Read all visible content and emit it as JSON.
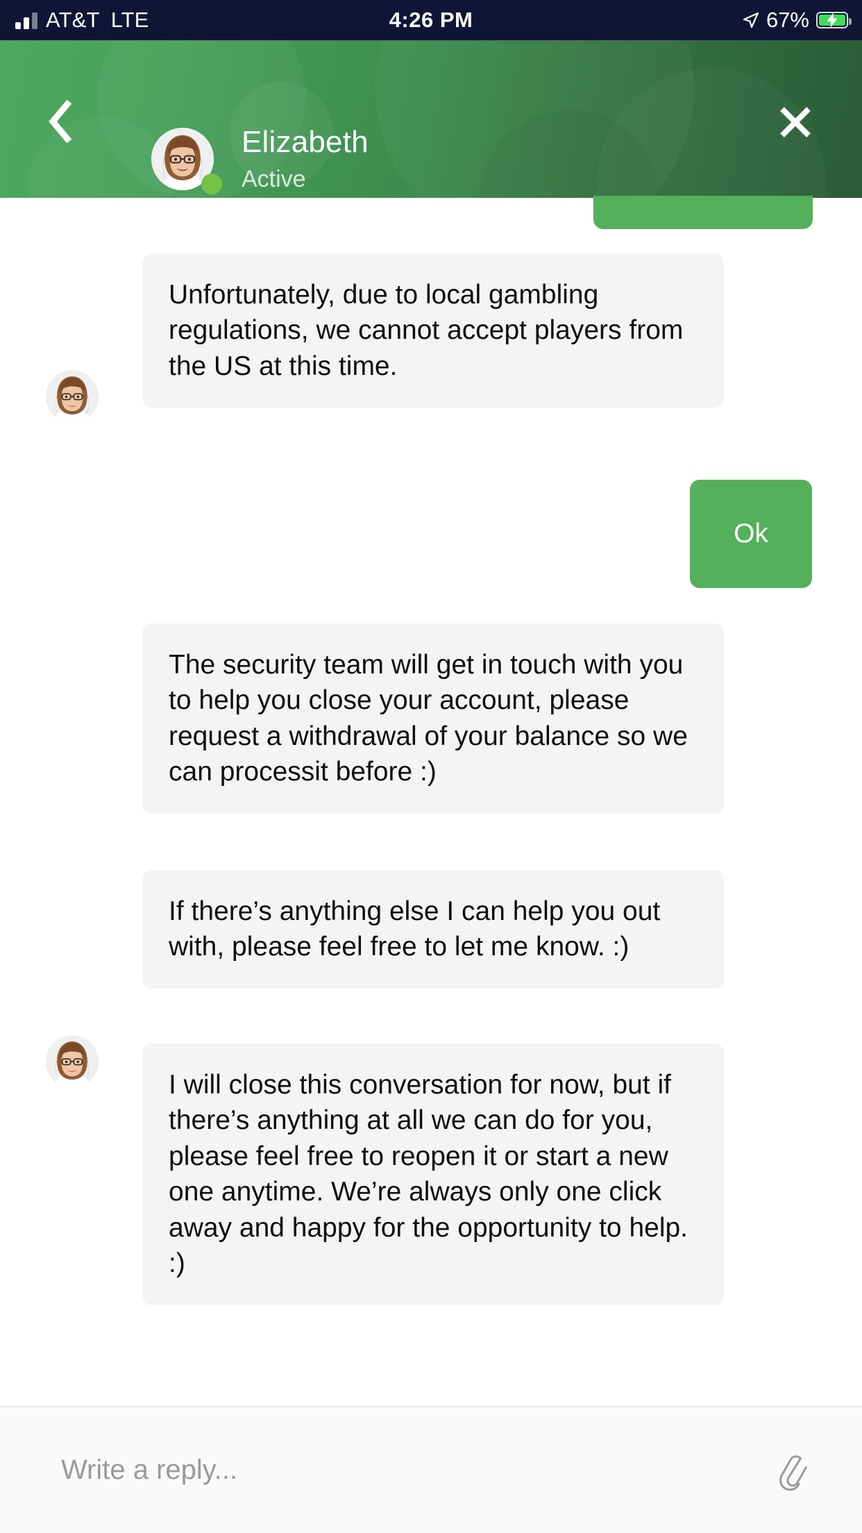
{
  "status_bar": {
    "carrier": "AT&T",
    "network": "LTE",
    "time": "4:26 PM",
    "battery_percent": "67%",
    "location_icon": "location-arrow-icon",
    "battery_icon": "battery-charging-icon",
    "signal_icon": "signal-bars-icon",
    "background_color": "#101536"
  },
  "header": {
    "back_icon": "chevron-left-icon",
    "close_icon": "close-x-icon",
    "name": "Elizabeth",
    "status": "Active",
    "avatar_name": "agent-avatar",
    "presence_dot_color": "#76c043",
    "gradient_from": "#4fa85f",
    "gradient_to": "#2a5c36"
  },
  "conversation": {
    "messages": [
      {
        "id": "m0",
        "sender": "user",
        "text": "",
        "partial": true
      },
      {
        "id": "m1",
        "sender": "agent",
        "text": "Unfortunately, due to local gambling regulations, we cannot accept players from the US at this time.",
        "show_avatar": true
      },
      {
        "id": "m2",
        "sender": "user",
        "text": "Ok",
        "show_avatar": false
      },
      {
        "id": "m3",
        "sender": "agent",
        "text": "The security team will get in touch with you to help you close your account, please request a withdrawal of your balance so we can processit before :)",
        "show_avatar": false
      },
      {
        "id": "m4",
        "sender": "agent",
        "text": "If there’s anything else I can help you out with, please feel free to let me know. :)",
        "show_avatar": false
      },
      {
        "id": "m5",
        "sender": "agent",
        "text": "I will close this conversation for now, but if there’s anything at all we can do for you, please feel free to reopen it or start a new one anytime. We’re always only one click away and happy for the opportunity to help. :)",
        "show_avatar": true
      }
    ],
    "incoming_bubble_color": "#f3f4f4",
    "outgoing_bubble_color": "#55b05b"
  },
  "composer": {
    "placeholder": "Write a reply...",
    "value": "",
    "attach_icon": "paperclip-icon"
  }
}
